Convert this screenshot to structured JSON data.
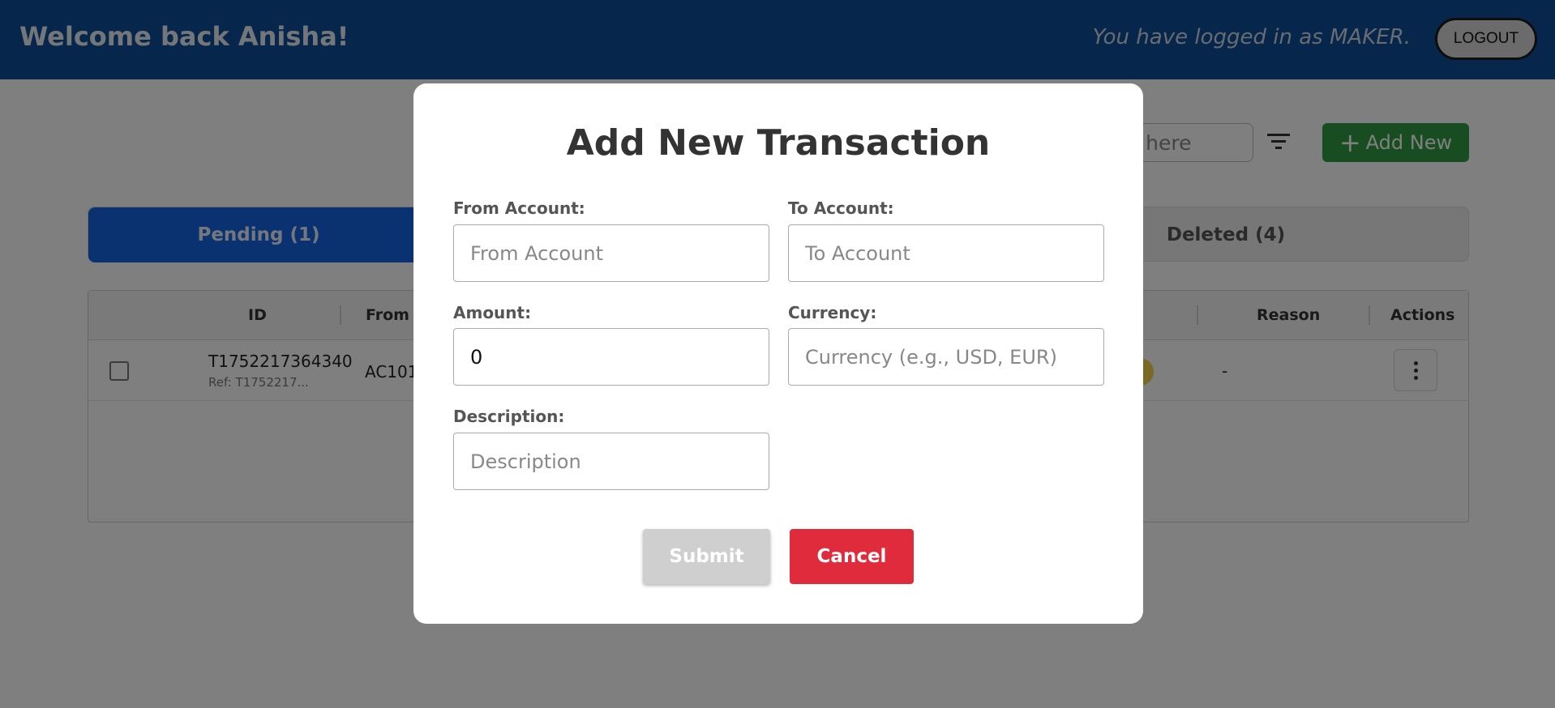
{
  "header": {
    "welcome": "Welcome back Anisha!",
    "logged_in_text": "You have logged in as MAKER.",
    "logout_label": "LOGOUT"
  },
  "toolbar": {
    "search_text": "ons here",
    "filter_icon": "filter-icon",
    "add_new_label": "Add New",
    "add_new_plus": "+"
  },
  "tabs": {
    "pending": "Pending (1)",
    "deleted": "Deleted (4)"
  },
  "table": {
    "headers": {
      "id": "ID",
      "from": "From",
      "reason": "Reason",
      "actions": "Actions"
    },
    "rows": [
      {
        "id": "T1752217364340",
        "ref": "Ref: T1752217...",
        "from": "AC101",
        "reason": "-"
      }
    ]
  },
  "modal": {
    "title": "Add New Transaction",
    "from_account": {
      "label": "From Account:",
      "placeholder": "From Account",
      "value": ""
    },
    "to_account": {
      "label": "To Account:",
      "placeholder": "To Account",
      "value": ""
    },
    "amount": {
      "label": "Amount:",
      "placeholder": "",
      "value": "0"
    },
    "currency": {
      "label": "Currency:",
      "placeholder": "Currency (e.g., USD, EUR)",
      "value": ""
    },
    "description": {
      "label": "Description:",
      "placeholder": "Description",
      "value": ""
    },
    "submit_label": "Submit",
    "cancel_label": "Cancel"
  },
  "colors": {
    "header_bg": "#0d4c96",
    "tab_active": "#1565e0",
    "add_new": "#2e9a42",
    "cancel": "#e02b3d",
    "submit_disabled": "#cfcfcf"
  }
}
